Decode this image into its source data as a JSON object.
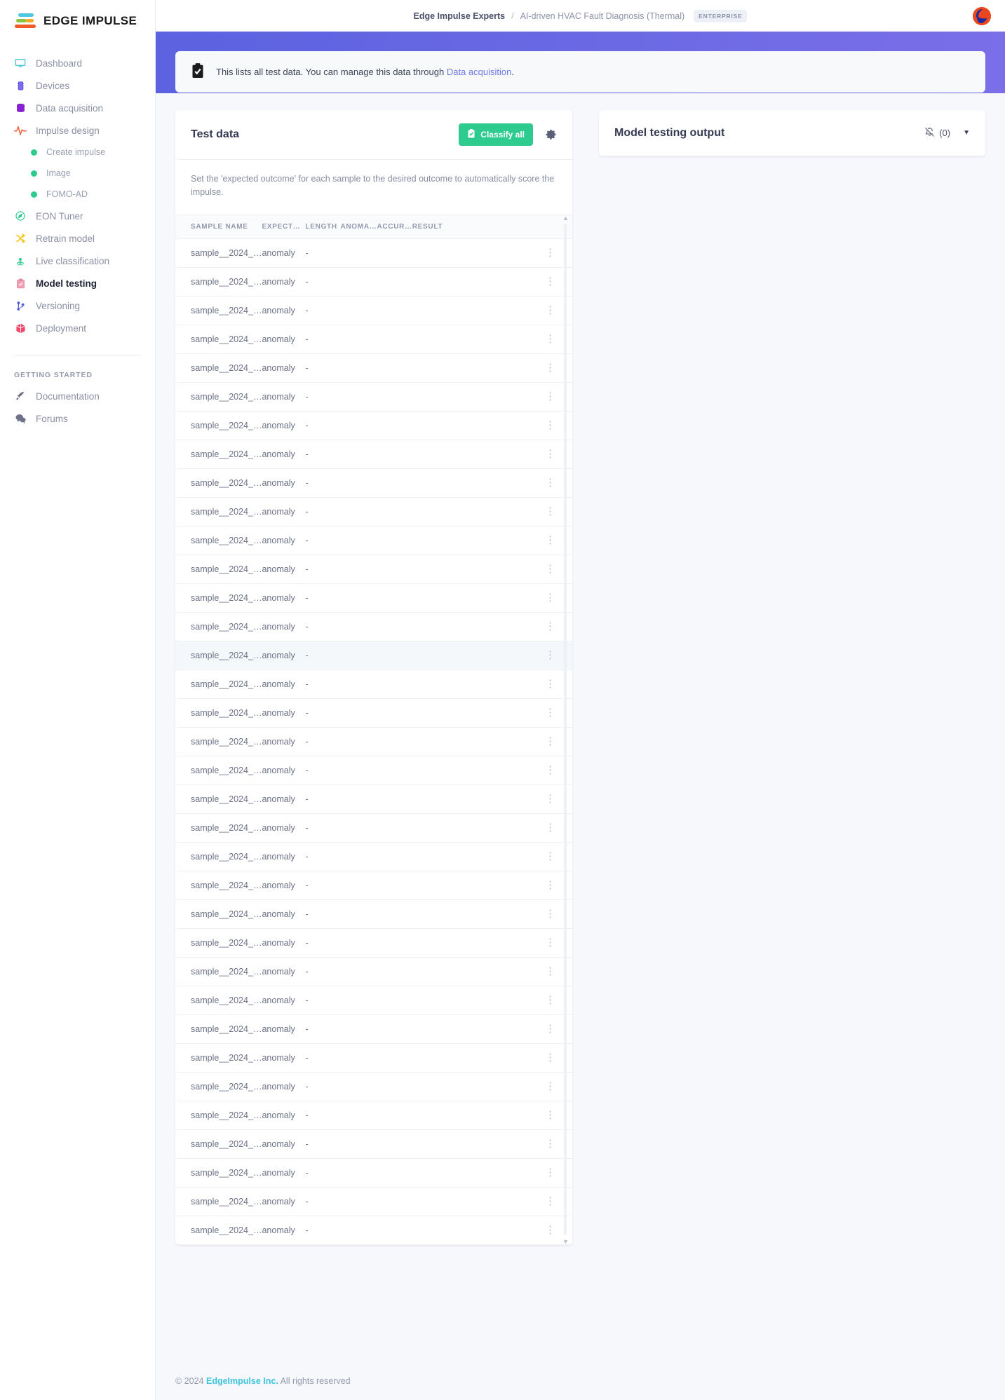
{
  "brand": {
    "name": "EDGE IMPULSE",
    "logo_icon": "edge-impulse-logo"
  },
  "sidebar": {
    "items": [
      {
        "label": "Dashboard",
        "icon": "monitor-icon",
        "active": false
      },
      {
        "label": "Devices",
        "icon": "chip-icon",
        "active": false
      },
      {
        "label": "Data acquisition",
        "icon": "database-icon",
        "active": false
      },
      {
        "label": "Impulse design",
        "icon": "pulse-icon",
        "active": false
      }
    ],
    "sub_items": [
      {
        "label": "Create impulse",
        "icon": "dot-icon"
      },
      {
        "label": "Image",
        "icon": "dot-icon"
      },
      {
        "label": "FOMO-AD",
        "icon": "dot-icon"
      }
    ],
    "items2": [
      {
        "label": "EON Tuner",
        "icon": "compass-icon",
        "active": false
      },
      {
        "label": "Retrain model",
        "icon": "shuffle-icon",
        "active": false
      },
      {
        "label": "Live classification",
        "icon": "antenna-icon",
        "active": false
      },
      {
        "label": "Model testing",
        "icon": "clipboard-check-icon",
        "active": true
      },
      {
        "label": "Versioning",
        "icon": "branch-icon",
        "active": false
      },
      {
        "label": "Deployment",
        "icon": "box-icon",
        "active": false
      }
    ],
    "group_title": "GETTING STARTED",
    "items3": [
      {
        "label": "Documentation",
        "icon": "rocket-icon",
        "active": false
      },
      {
        "label": "Forums",
        "icon": "chat-icon",
        "active": false
      }
    ]
  },
  "header": {
    "org": "Edge Impulse Experts",
    "separator": "/",
    "project": "AI-driven HVAC Fault Diagnosis (Thermal)",
    "badge": "ENTERPRISE",
    "avatar_icon": "user-avatar"
  },
  "notice": {
    "icon": "clipboard-icon",
    "text_before": "This lists all test data. You can manage this data through ",
    "link": "Data acquisition",
    "text_after": "."
  },
  "test_data_card": {
    "title": "Test data",
    "classify_all_label": "Classify all",
    "classify_all_icon": "clipboard-icon",
    "settings_icon": "gear-icon",
    "note": "Set the 'expected outcome' for each sample to the desired outcome to automatically score the impulse.",
    "columns": [
      "SAMPLE NAME",
      "EXPECT…",
      "LENGTH",
      "ANOMA…",
      "ACCUR…",
      "RESULT"
    ],
    "rows": [
      {
        "name": "sample__2024_…",
        "expected": "anomaly",
        "length": "-",
        "anomaly": "",
        "accuracy": "",
        "result": "",
        "selected": false
      },
      {
        "name": "sample__2024_…",
        "expected": "anomaly",
        "length": "-",
        "anomaly": "",
        "accuracy": "",
        "result": "",
        "selected": false
      },
      {
        "name": "sample__2024_…",
        "expected": "anomaly",
        "length": "-",
        "anomaly": "",
        "accuracy": "",
        "result": "",
        "selected": false
      },
      {
        "name": "sample__2024_…",
        "expected": "anomaly",
        "length": "-",
        "anomaly": "",
        "accuracy": "",
        "result": "",
        "selected": false
      },
      {
        "name": "sample__2024_…",
        "expected": "anomaly",
        "length": "-",
        "anomaly": "",
        "accuracy": "",
        "result": "",
        "selected": false
      },
      {
        "name": "sample__2024_…",
        "expected": "anomaly",
        "length": "-",
        "anomaly": "",
        "accuracy": "",
        "result": "",
        "selected": false
      },
      {
        "name": "sample__2024_…",
        "expected": "anomaly",
        "length": "-",
        "anomaly": "",
        "accuracy": "",
        "result": "",
        "selected": false
      },
      {
        "name": "sample__2024_…",
        "expected": "anomaly",
        "length": "-",
        "anomaly": "",
        "accuracy": "",
        "result": "",
        "selected": false
      },
      {
        "name": "sample__2024_…",
        "expected": "anomaly",
        "length": "-",
        "anomaly": "",
        "accuracy": "",
        "result": "",
        "selected": false
      },
      {
        "name": "sample__2024_…",
        "expected": "anomaly",
        "length": "-",
        "anomaly": "",
        "accuracy": "",
        "result": "",
        "selected": false
      },
      {
        "name": "sample__2024_…",
        "expected": "anomaly",
        "length": "-",
        "anomaly": "",
        "accuracy": "",
        "result": "",
        "selected": false
      },
      {
        "name": "sample__2024_…",
        "expected": "anomaly",
        "length": "-",
        "anomaly": "",
        "accuracy": "",
        "result": "",
        "selected": false
      },
      {
        "name": "sample__2024_…",
        "expected": "anomaly",
        "length": "-",
        "anomaly": "",
        "accuracy": "",
        "result": "",
        "selected": false
      },
      {
        "name": "sample__2024_…",
        "expected": "anomaly",
        "length": "-",
        "anomaly": "",
        "accuracy": "",
        "result": "",
        "selected": false
      },
      {
        "name": "sample__2024_…",
        "expected": "anomaly",
        "length": "-",
        "anomaly": "",
        "accuracy": "",
        "result": "",
        "selected": true
      },
      {
        "name": "sample__2024_…",
        "expected": "anomaly",
        "length": "-",
        "anomaly": "",
        "accuracy": "",
        "result": "",
        "selected": false
      },
      {
        "name": "sample__2024_…",
        "expected": "anomaly",
        "length": "-",
        "anomaly": "",
        "accuracy": "",
        "result": "",
        "selected": false
      },
      {
        "name": "sample__2024_…",
        "expected": "anomaly",
        "length": "-",
        "anomaly": "",
        "accuracy": "",
        "result": "",
        "selected": false
      },
      {
        "name": "sample__2024_…",
        "expected": "anomaly",
        "length": "-",
        "anomaly": "",
        "accuracy": "",
        "result": "",
        "selected": false
      },
      {
        "name": "sample__2024_…",
        "expected": "anomaly",
        "length": "-",
        "anomaly": "",
        "accuracy": "",
        "result": "",
        "selected": false
      },
      {
        "name": "sample__2024_…",
        "expected": "anomaly",
        "length": "-",
        "anomaly": "",
        "accuracy": "",
        "result": "",
        "selected": false
      },
      {
        "name": "sample__2024_…",
        "expected": "anomaly",
        "length": "-",
        "anomaly": "",
        "accuracy": "",
        "result": "",
        "selected": false
      },
      {
        "name": "sample__2024_…",
        "expected": "anomaly",
        "length": "-",
        "anomaly": "",
        "accuracy": "",
        "result": "",
        "selected": false
      },
      {
        "name": "sample__2024_…",
        "expected": "anomaly",
        "length": "-",
        "anomaly": "",
        "accuracy": "",
        "result": "",
        "selected": false
      },
      {
        "name": "sample__2024_…",
        "expected": "anomaly",
        "length": "-",
        "anomaly": "",
        "accuracy": "",
        "result": "",
        "selected": false
      },
      {
        "name": "sample__2024_…",
        "expected": "anomaly",
        "length": "-",
        "anomaly": "",
        "accuracy": "",
        "result": "",
        "selected": false
      },
      {
        "name": "sample__2024_…",
        "expected": "anomaly",
        "length": "-",
        "anomaly": "",
        "accuracy": "",
        "result": "",
        "selected": false
      },
      {
        "name": "sample__2024_…",
        "expected": "anomaly",
        "length": "-",
        "anomaly": "",
        "accuracy": "",
        "result": "",
        "selected": false
      },
      {
        "name": "sample__2024_…",
        "expected": "anomaly",
        "length": "-",
        "anomaly": "",
        "accuracy": "",
        "result": "",
        "selected": false
      },
      {
        "name": "sample__2024_…",
        "expected": "anomaly",
        "length": "-",
        "anomaly": "",
        "accuracy": "",
        "result": "",
        "selected": false
      },
      {
        "name": "sample__2024_…",
        "expected": "anomaly",
        "length": "-",
        "anomaly": "",
        "accuracy": "",
        "result": "",
        "selected": false
      },
      {
        "name": "sample__2024_…",
        "expected": "anomaly",
        "length": "-",
        "anomaly": "",
        "accuracy": "",
        "result": "",
        "selected": false
      },
      {
        "name": "sample__2024_…",
        "expected": "anomaly",
        "length": "-",
        "anomaly": "",
        "accuracy": "",
        "result": "",
        "selected": false
      },
      {
        "name": "sample__2024_…",
        "expected": "anomaly",
        "length": "-",
        "anomaly": "",
        "accuracy": "",
        "result": "",
        "selected": false
      },
      {
        "name": "sample__2024_…",
        "expected": "anomaly",
        "length": "-",
        "anomaly": "",
        "accuracy": "",
        "result": "",
        "selected": false
      }
    ]
  },
  "output_card": {
    "title": "Model testing output",
    "mute_icon": "bell-off-icon",
    "mute_count": "(0)",
    "caret_icon": "chevron-down-icon"
  },
  "footer": {
    "copyright": "© 2024",
    "company": "EdgeImpulse Inc.",
    "rights": "All rights reserved"
  },
  "colors": {
    "accent": "#5b62e0",
    "success": "#2ecb8f",
    "link": "#6f7ae8",
    "brand_cyan": "#3fc3dd"
  }
}
